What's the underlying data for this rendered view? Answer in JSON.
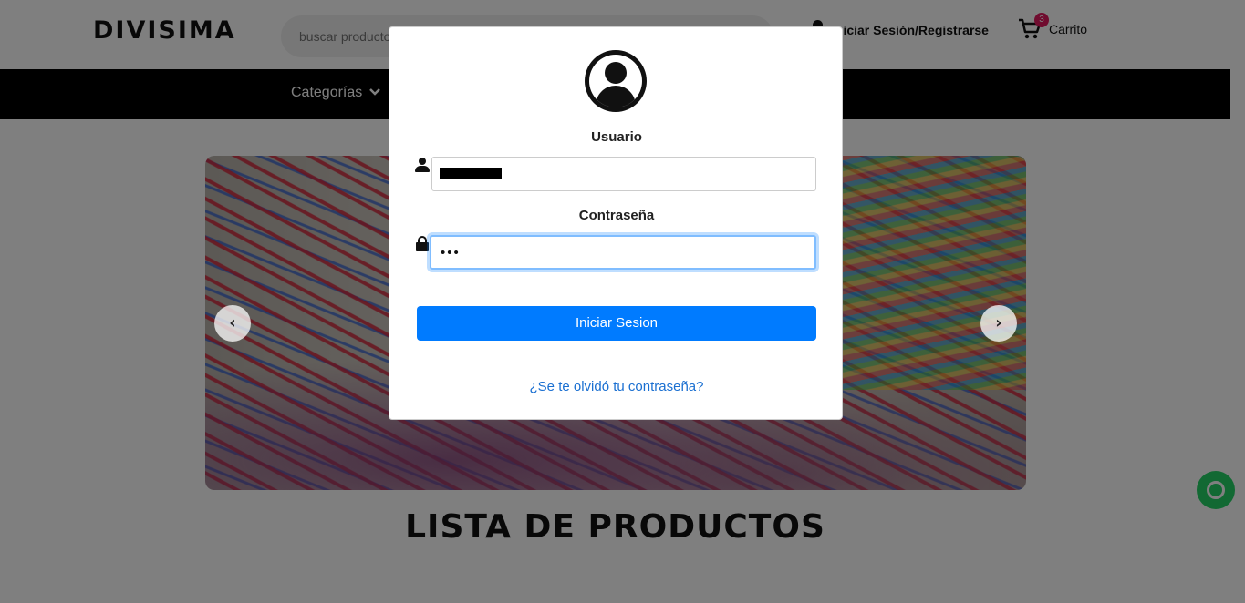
{
  "header": {
    "logo": "DIVISIMA",
    "search_placeholder": "buscar productos",
    "login_label": "Iniciar Sesión/Registrarse",
    "cart_count": "3",
    "cart_label": "Carrito"
  },
  "nav": {
    "categories_label": "Categorías"
  },
  "carousel": {
    "prev_icon": "chevron-left",
    "next_icon": "chevron-right",
    "prev_glyph": "‹",
    "next_glyph": "›"
  },
  "main": {
    "products_title": "LISTA DE PRODUCTOS"
  },
  "modal": {
    "user_label": "Usuario",
    "password_label": "Contraseña",
    "password_value": "•••",
    "login_button": "Iniciar Sesion",
    "forgot_link": "¿Se te olvidó tu contraseña?"
  },
  "colors": {
    "primary_button": "#007bff",
    "brand_accent": "#e0195f",
    "navbar": "#000000",
    "focus_border": "#80bdff",
    "link": "#1a6fd1"
  }
}
